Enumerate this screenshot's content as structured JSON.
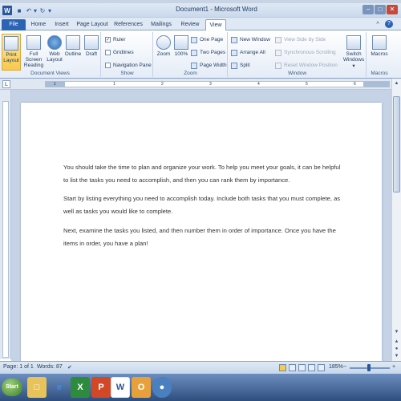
{
  "window": {
    "title": "Document1 - Microsoft Word"
  },
  "title_bar": {
    "logo": "W",
    "undo_icon": "undo-icon",
    "redo_icon": "redo-icon"
  },
  "tabs": [
    "File",
    "Home",
    "Insert",
    "Page Layout",
    "References",
    "Mailings",
    "Review",
    "View"
  ],
  "active_tab": "View",
  "ribbon": {
    "document_views": {
      "label": "Document Views",
      "buttons": [
        {
          "line1": "Print",
          "line2": "Layout"
        },
        {
          "line1": "Full Screen",
          "line2": "Reading"
        },
        {
          "line1": "Web",
          "line2": "Layout"
        },
        {
          "line1": "Outline",
          "line2": ""
        },
        {
          "line1": "Draft",
          "line2": ""
        }
      ]
    },
    "show": {
      "label": "Show",
      "ruler": "Ruler",
      "ruler_checked": true,
      "gridlines": "Gridlines",
      "gridlines_checked": false,
      "navigation_pane": "Navigation Pane",
      "navigation_pane_checked": false
    },
    "zoom": {
      "label": "Zoom",
      "zoom_button": "Zoom",
      "hundred_button": "100%",
      "one_page": "One Page",
      "two_pages": "Two Pages",
      "page_width": "Page Width"
    },
    "window_group": {
      "label": "Window",
      "new_window": "New Window",
      "arrange_all": "Arrange All",
      "split": "Split",
      "view_side_by_side": "View Side by Side",
      "synchronous_scrolling": "Synchronous Scrolling",
      "reset_window_position": "Reset Window Position",
      "switch_windows_1": "Switch",
      "switch_windows_2": "Windows ▾"
    },
    "macros": {
      "label": "Macros",
      "button": "Macros"
    }
  },
  "ruler": {
    "corner": "L",
    "numbers": [
      "1",
      "1",
      "2",
      "3",
      "4",
      "5",
      "6"
    ]
  },
  "document": {
    "paragraphs": [
      "You should take the time to plan and organize your work. To help you meet your goals, it can be helpful to list the tasks you need to accomplish, and then you can rank them by importance.",
      "Start by listing everything you need to accomplish today. Include both tasks that you must complete, as well as tasks you would like to complete.",
      "Next, examine the tasks you listed, and then number them in order of importance. Once you have the items in order, you have a plan!"
    ]
  },
  "status_bar": {
    "page": "Page: 1 of 1",
    "words": "Words: 87",
    "zoom_level": "185%",
    "zoom_minus": "−",
    "zoom_plus": "+"
  },
  "taskbar": {
    "start": "Start",
    "icons": [
      "folder-icon",
      "internet-explorer-icon",
      "excel-icon",
      "powerpoint-icon",
      "word-icon",
      "outlook-icon",
      "media-icon"
    ]
  },
  "colors": {
    "accent": "#2b63b5",
    "ribbon_active": "#f8c94a",
    "taskbar": "#2e4e7e"
  }
}
